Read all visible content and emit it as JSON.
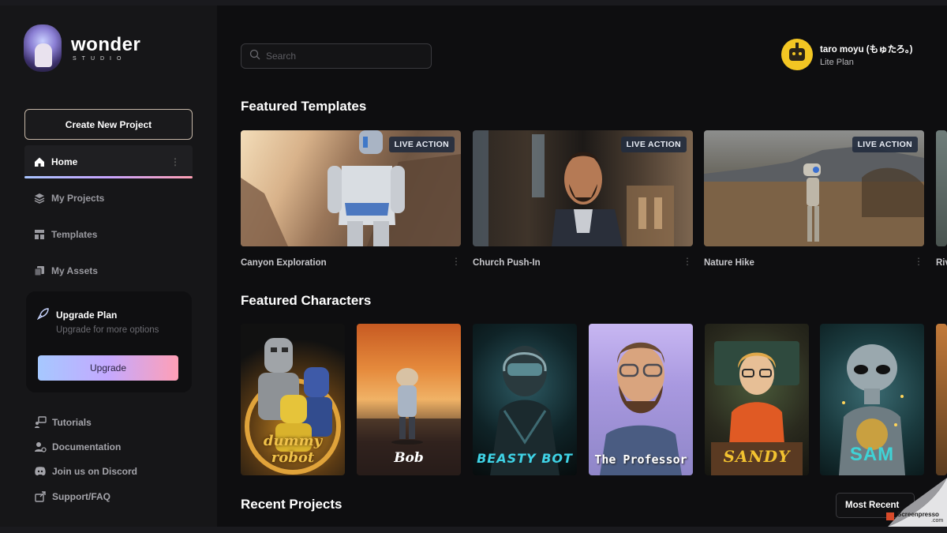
{
  "brand": {
    "name": "wonder",
    "subtitle": "STUDIO"
  },
  "sidebar": {
    "create_label": "Create New Project",
    "nav": [
      {
        "label": "Home",
        "icon": "home-icon",
        "active": true
      },
      {
        "label": "My Projects",
        "icon": "layers-icon",
        "active": false
      },
      {
        "label": "Templates",
        "icon": "templates-icon",
        "active": false
      },
      {
        "label": "My Assets",
        "icon": "assets-icon",
        "active": false
      }
    ],
    "upgrade": {
      "title": "Upgrade Plan",
      "subtitle": "Upgrade for more options",
      "button": "Upgrade"
    },
    "footer": [
      {
        "label": "Tutorials",
        "icon": "tutorials-icon"
      },
      {
        "label": "Documentation",
        "icon": "documentation-icon"
      },
      {
        "label": "Join us on Discord",
        "icon": "discord-icon"
      },
      {
        "label": "Support/FAQ",
        "icon": "support-icon"
      }
    ]
  },
  "search": {
    "placeholder": "Search"
  },
  "user": {
    "name": "taro moyu (もゅたろ。)",
    "plan": "Lite Plan"
  },
  "featured_templates": {
    "title": "Featured Templates",
    "items": [
      {
        "name": "Canyon Exploration",
        "badge": "LIVE ACTION"
      },
      {
        "name": "Church Push-In",
        "badge": "LIVE ACTION"
      },
      {
        "name": "Nature Hike",
        "badge": "LIVE ACTION"
      },
      {
        "name": "Riv",
        "badge": ""
      }
    ]
  },
  "featured_characters": {
    "title": "Featured Characters",
    "items": [
      {
        "name": "dummy robot"
      },
      {
        "name": "Bob"
      },
      {
        "name": "BEASTY BOT"
      },
      {
        "name": "The Professor"
      },
      {
        "name": "SANDY"
      },
      {
        "name": "SAM"
      }
    ]
  },
  "recent_projects": {
    "title": "Recent Projects",
    "sort_label": "Most Recent"
  },
  "watermark": {
    "text": "Screenpresso",
    "domain": ".com"
  },
  "colors": {
    "accent_gradient": [
      "#a6c8ff",
      "#c4a9ff",
      "#ff9fb6"
    ],
    "background": "#0e0e10",
    "sidebar": "#161618"
  }
}
